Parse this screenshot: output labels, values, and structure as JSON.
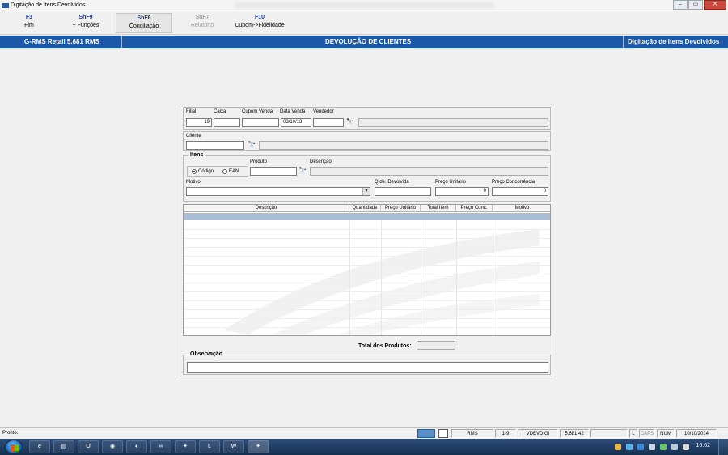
{
  "window": {
    "title": "Digitação de Itens Devolvidos"
  },
  "function_keys": [
    {
      "key": "F3",
      "label": "Fim",
      "state": "normal"
    },
    {
      "key": "ShF9",
      "label": "+ Funções",
      "state": "normal"
    },
    {
      "key": "ShF6",
      "label": "Conciliação",
      "state": "pressed"
    },
    {
      "key": "ShF7",
      "label": "Relatório",
      "state": "disabled"
    },
    {
      "key": "F10",
      "label": "Cupom->Fidelidade",
      "state": "normal"
    }
  ],
  "header": {
    "app": "G-RMS Retail 5.681 RMS",
    "module": "DEVOLUÇÃO DE CLIENTES",
    "screen": "Digitação de Itens Devolvidos"
  },
  "sale": {
    "filial_label": "Filial",
    "filial_value": "19",
    "caixa_label": "Caixa",
    "caixa_value": "",
    "cupom_label": "Cupom Venda",
    "cupom_value": "",
    "data_label": "Data Venda",
    "data_value": "03/10/13",
    "vendedor_label": "Vendedor",
    "vendedor_value": ""
  },
  "cliente": {
    "label": "Cliente",
    "value": ""
  },
  "itens": {
    "legend": "Itens",
    "radio_codigo": "Código",
    "radio_ean": "EAN",
    "selected": "Código",
    "produto_label": "Produto",
    "produto_value": "",
    "descricao_label": "Descrição",
    "motivo_label": "Motivo",
    "motivo_value": "",
    "qtde_label": "Qtde. Devolvida",
    "qtde_value": "",
    "preco_unit_label": "Preço Unitário",
    "preco_unit_value": "0",
    "preco_conc_label": "Preço Concorrência",
    "preco_conc_value": "0"
  },
  "grid": {
    "columns": [
      "Descrição",
      "Quantidade",
      "Preço Unitário",
      "Total Item",
      "Preço Conc.",
      "Motivo"
    ],
    "rows": []
  },
  "total": {
    "label": "Total dos Produtos:",
    "value": ""
  },
  "observacao": {
    "legend": "Observação",
    "value": ""
  },
  "statusbar": {
    "message": "Pronto.",
    "panels": [
      "RMS",
      "1-9",
      "VDEVDIGI",
      "5.681.42",
      "",
      "L",
      "CAPS",
      "NUM",
      "10/10/2014"
    ]
  },
  "taskbar": {
    "clock": "16:02"
  },
  "colors": {
    "accent_bar": "#1b59a8",
    "selected_row": "#a9bed6"
  }
}
